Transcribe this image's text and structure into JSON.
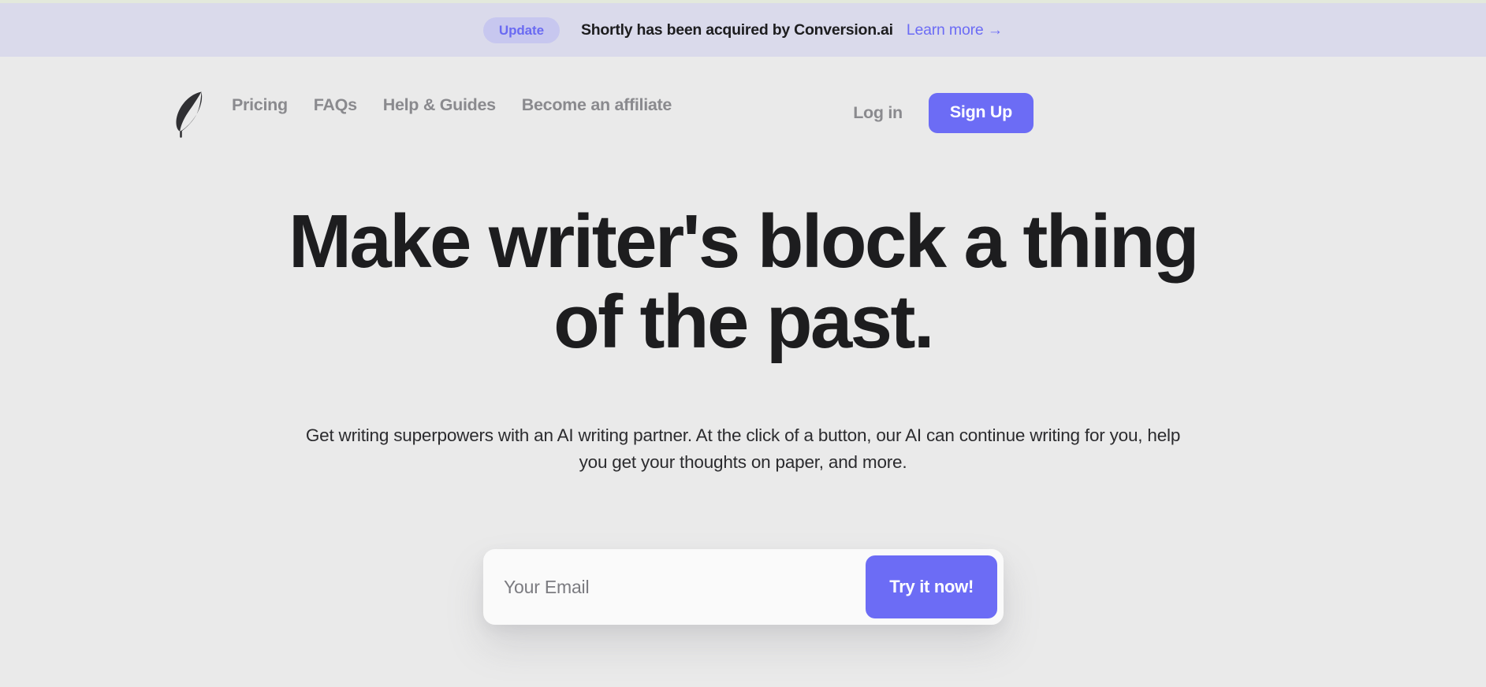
{
  "banner": {
    "badge_label": "Update",
    "message": "Shortly has been acquired by Conversion.ai",
    "link_label": "Learn more →",
    "bg_color": "#dadaeb",
    "badge_bg_color": "#c7c7ef",
    "link_color": "#6c6cf5"
  },
  "nav": {
    "logo_name": "feather-quill-logo",
    "links": [
      {
        "label": "Pricing"
      },
      {
        "label": "FAQs"
      },
      {
        "label": "Help & Guides"
      },
      {
        "label": "Become an affiliate"
      }
    ],
    "login_label": "Log in",
    "signup_label": "Sign Up",
    "accent_color": "#6c6cf5"
  },
  "hero": {
    "headline": "Make writer's block a thing of the past.",
    "subheadline": "Get writing superpowers with an AI writing partner. At the click of a button, our AI can continue writing for you, help you get your thoughts on paper, and more."
  },
  "signup_form": {
    "email_placeholder": "Your Email",
    "email_value": "",
    "submit_label": "Try it now!",
    "submit_color": "#6c6cf5"
  },
  "theme": {
    "page_bg": "#eaeaea",
    "text_primary": "#1d1d1f",
    "text_muted": "#8a8a8e",
    "top_strip": "#e3e9dc"
  }
}
